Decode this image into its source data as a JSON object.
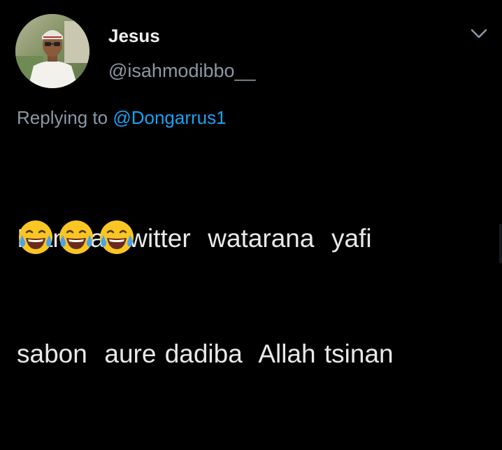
{
  "tweet": {
    "display_name": "Jesus",
    "handle": "@isahmodibbo__",
    "replying_prefix": "Replying to",
    "replying_to": "@Dongarrus1",
    "text_line1": "Idan ba  twitter  watarana  yafi",
    "text_line2": "sabon  aure dadiba  Allah tsinan",
    "emojis": [
      "face-with-tears-of-joy",
      "face-with-tears-of-joy",
      "face-with-tears-of-joy"
    ]
  },
  "icons": {
    "menu": "chevron-down-icon",
    "avatar": "avatar"
  },
  "colors": {
    "background": "#000000",
    "primary_text": "#e8e8e8",
    "secondary_text": "#8b98a5",
    "link": "#1da1f2",
    "emoji_face": "#f9c623",
    "emoji_tears": "#4aa3e8"
  }
}
